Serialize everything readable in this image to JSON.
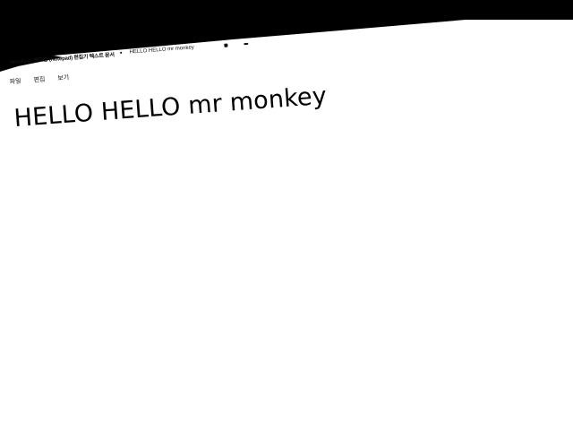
{
  "window": {
    "app_name": "Windows 메모장 (Notepad) 편집기 텍스트 문서",
    "separator": "●",
    "title": "HELLO HELLO mr monkey"
  },
  "menubar": {
    "items": [
      {
        "label": "파일"
      },
      {
        "label": "편집"
      },
      {
        "label": "보기"
      }
    ]
  },
  "editor": {
    "text": "HELLO HELLO mr monkey"
  },
  "colors": {
    "background": "#ffffff",
    "outside_screen": "#000000",
    "text": "#000000"
  }
}
